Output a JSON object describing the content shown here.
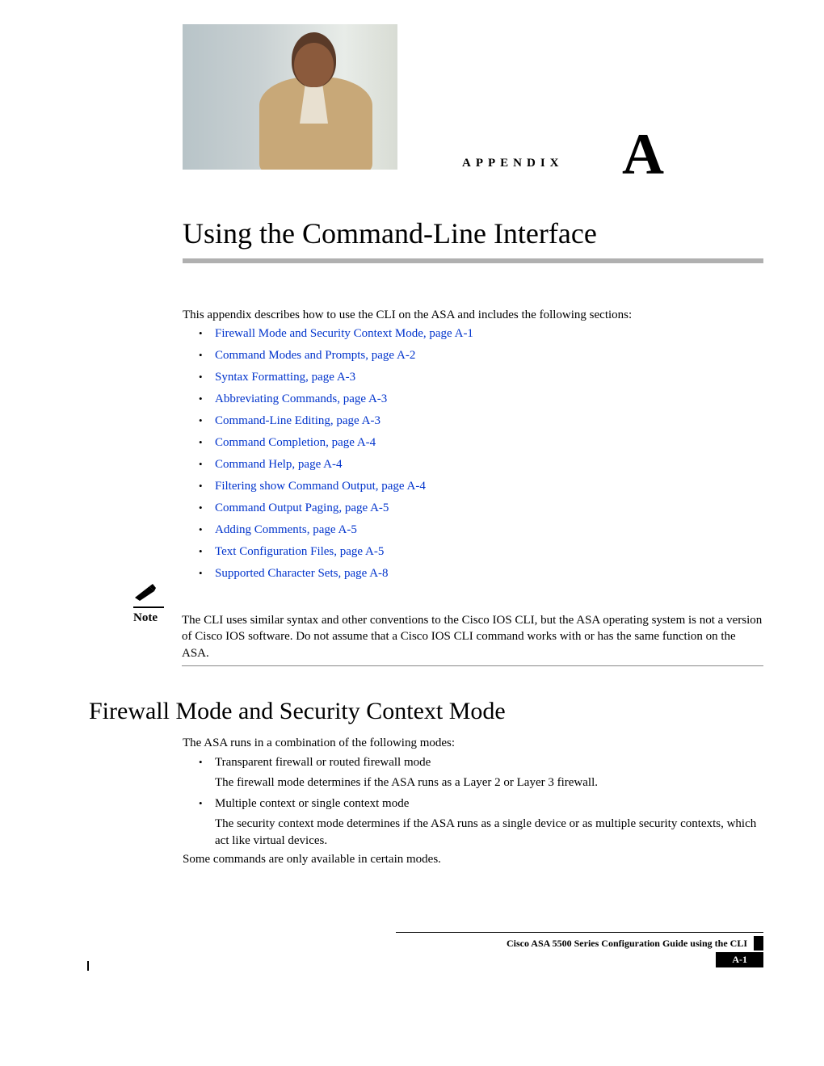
{
  "header": {
    "appendix_label": "APPENDIX",
    "appendix_letter": "A",
    "chapter_title": "Using the Command-Line Interface"
  },
  "intro": "This appendix describes how to use the CLI on the ASA and includes the following sections:",
  "links": [
    "Firewall Mode and Security Context Mode, page A-1",
    "Command Modes and Prompts, page A-2",
    "Syntax Formatting, page A-3",
    "Abbreviating Commands, page A-3",
    "Command-Line Editing, page A-3",
    "Command Completion, page A-4",
    "Command Help, page A-4",
    "Filtering show Command Output, page A-4",
    "Command Output Paging, page A-5",
    "Adding Comments, page A-5",
    "Text Configuration Files, page A-5",
    "Supported Character Sets, page A-8"
  ],
  "note": {
    "label": "Note",
    "text": "The CLI uses similar syntax and other conventions to the Cisco IOS CLI, but the ASA operating system is not a version of Cisco IOS software. Do not assume that a Cisco IOS CLI command works with or has the same function on the ASA."
  },
  "section": {
    "heading": "Firewall Mode and Security Context Mode",
    "intro": "The ASA runs in a combination of the following modes:",
    "modes": [
      {
        "title": "Transparent firewall or routed firewall mode",
        "desc": "The firewall mode determines if the ASA runs as a Layer 2 or Layer 3 firewall."
      },
      {
        "title": "Multiple context or single context mode",
        "desc": "The security context mode determines if the ASA runs as a single device or as multiple security contexts, which act like virtual devices."
      }
    ],
    "closing": "Some commands are only available in certain modes."
  },
  "footer": {
    "doc_title": "Cisco ASA 5500 Series Configuration Guide using the CLI",
    "page_number": "A-1"
  }
}
